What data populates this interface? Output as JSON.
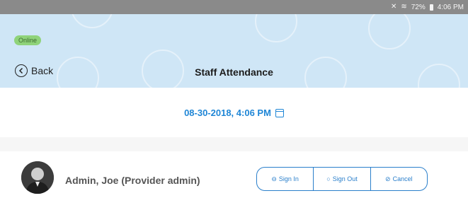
{
  "status_bar": {
    "mute_icon": "vibrate-mute-icon",
    "wifi_icon": "wifi-icon",
    "battery": "72%",
    "time": "4:06 PM"
  },
  "header": {
    "online_badge": "Online",
    "back_label": "Back",
    "title": "Staff Attendance",
    "background_color": "#cfe6f6"
  },
  "date": {
    "value": "08-30-2018, 4:06 PM",
    "color": "#1f86d6"
  },
  "staff": {
    "name": "Admin, Joe (Provider admin)",
    "actions": {
      "sign_in": "Sign In",
      "sign_out": "Sign Out",
      "cancel": "Cancel"
    },
    "accent_color": "#2a7fcb"
  }
}
